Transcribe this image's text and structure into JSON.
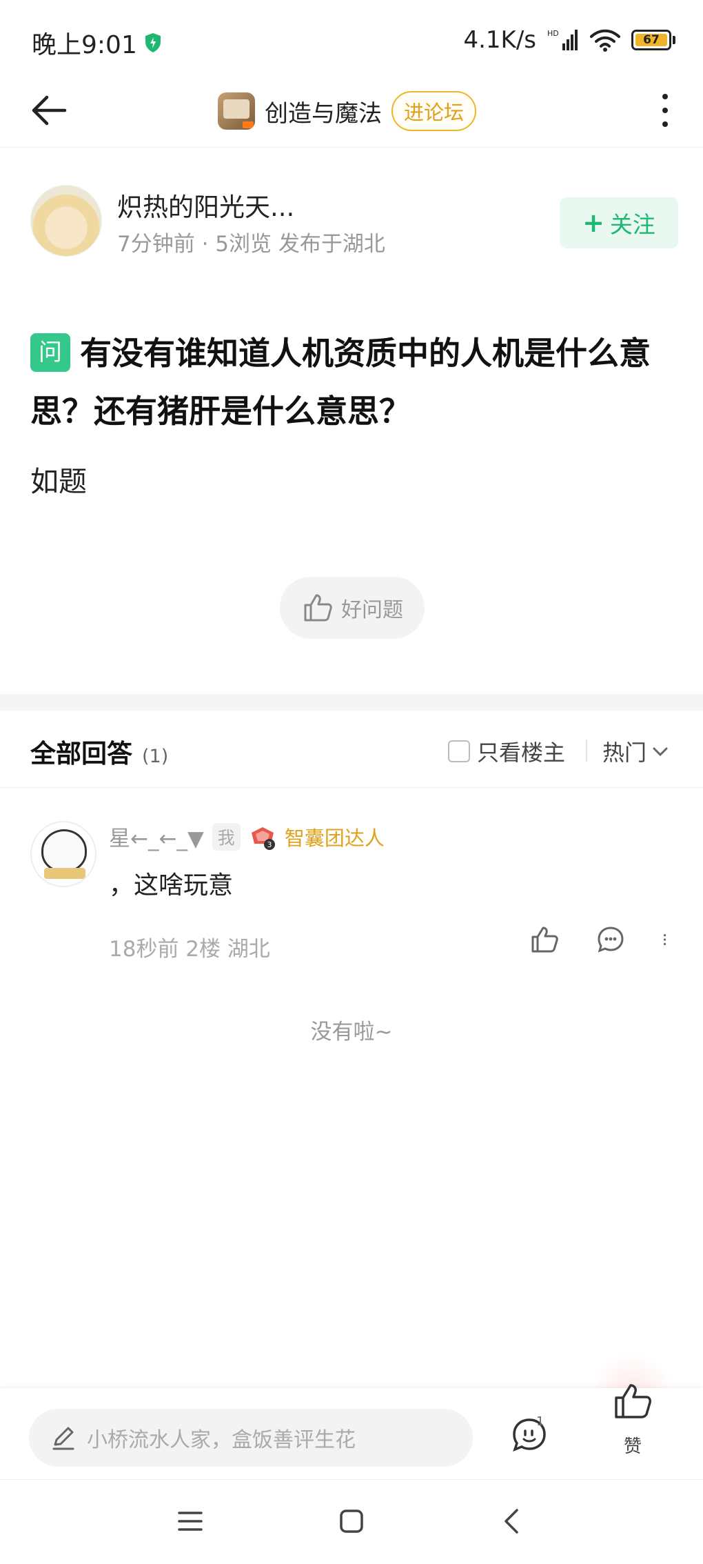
{
  "status_bar": {
    "time": "晚上9:01",
    "network_speed": "4.1K/s",
    "network_type": "HD",
    "battery": "67"
  },
  "nav": {
    "forum_name": "创造与魔法",
    "enter_forum_label": "进论坛"
  },
  "author": {
    "name": "炽热的阳光天...",
    "meta": "7分钟前 · 5浏览  发布于湖北",
    "follow_label": "关注"
  },
  "question": {
    "badge": "问",
    "title": "有没有谁知道人机资质中的人机是什么意思？还有猪肝是什么意思？",
    "body": "如题",
    "good_question_label": "好问题"
  },
  "answers": {
    "title": "全部回答",
    "count": "(1)",
    "only_op_label": "只看楼主",
    "sort_label": "热门",
    "items": [
      {
        "name": "星←_←_▼",
        "me_tag": "我",
        "medal_level": "3",
        "talent_label": "智囊团达人",
        "text": "，这啥玩意",
        "meta": "18秒前  2楼  湖北"
      }
    ],
    "no_more": "没有啦~"
  },
  "bottom_bar": {
    "input_placeholder": "小桥流水人家，盒饭善评生花",
    "message_count": "1",
    "like_label": "赞"
  },
  "colors": {
    "brand_green": "#1fb873",
    "question_badge": "#34c98a",
    "forum_accent": "#e0a21c"
  },
  "icons": {
    "back": "arrow-left-icon",
    "more": "more-vertical-icon",
    "thumb": "thumbs-up-icon",
    "comment": "chat-bubble-icon",
    "pencil": "pencil-icon"
  }
}
